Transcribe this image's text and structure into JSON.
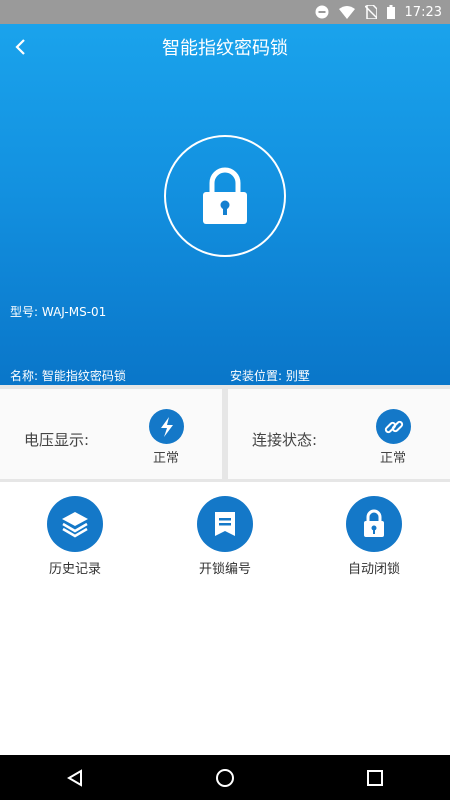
{
  "status_bar": {
    "time": "17:23"
  },
  "header": {
    "title": "智能指纹密码锁"
  },
  "device": {
    "model": "型号: WAJ-MS-01",
    "name": "名称: 智能指纹密码锁",
    "location": "安装位置: 别墅"
  },
  "status_cards": [
    {
      "label": "电压显示:",
      "status": "正常",
      "icon": "lightning-icon"
    },
    {
      "label": "连接状态:",
      "status": "正常",
      "icon": "link-icon"
    }
  ],
  "menu": [
    {
      "label": "历史记录",
      "icon": "layers-icon"
    },
    {
      "label": "开锁编号",
      "icon": "bookmark-list-icon"
    },
    {
      "label": "自动闭锁",
      "icon": "lock-icon"
    }
  ],
  "colors": {
    "primary": "#1478c8",
    "hero_top": "#1aa3ec",
    "hero_bottom": "#0a76c9"
  }
}
